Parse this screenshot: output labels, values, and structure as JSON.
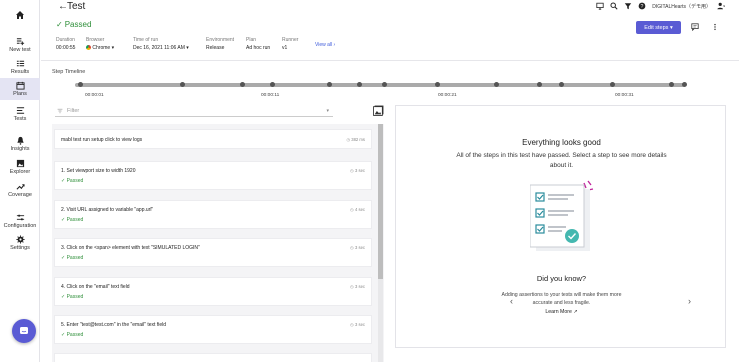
{
  "sidebar": {
    "home": "home",
    "items": [
      {
        "label": "New test",
        "icon": "new-test-icon"
      },
      {
        "label": "Results",
        "icon": "results-icon"
      },
      {
        "label": "Plans",
        "icon": "calendar-icon"
      },
      {
        "label": "Tests",
        "icon": "tests-icon"
      },
      {
        "label": "Insights",
        "icon": "bell-icon"
      },
      {
        "label": "Explorer",
        "icon": "image-icon"
      },
      {
        "label": "Coverage",
        "icon": "trend-icon"
      },
      {
        "label": "Configuration",
        "icon": "sliders-icon"
      },
      {
        "label": "Settings",
        "icon": "gear-icon"
      }
    ]
  },
  "header": {
    "title": "Test",
    "org": "DIGITALHearts（デモ用）",
    "status": "Passed"
  },
  "meta": {
    "duration_label": "Duration",
    "duration": "00:00:55",
    "browser_label": "Browser",
    "browser": "Chrome",
    "time_label": "Time of run",
    "time": "Dec 16, 2021 11:06 AM",
    "env_label": "Environment",
    "env": "Release",
    "plan_label": "Plan",
    "plan": "Ad hoc run",
    "runner_label": "Runner",
    "runner": "v1",
    "view_all": "View all ›"
  },
  "toolbar": {
    "edit_steps": "Edit steps ▾"
  },
  "timeline": {
    "label": "Step Timeline",
    "ticks": [
      "00:00:01",
      "00:00:11",
      "00:00:21",
      "00:00:31"
    ]
  },
  "filter": {
    "placeholder": "Filter"
  },
  "steps": [
    {
      "title": "mabl test run setup click to view logs",
      "status": "",
      "duration": "382 ms"
    },
    {
      "title": "1. Set viewport size to width 1920",
      "status": "Passed",
      "duration": "3 sec"
    },
    {
      "title": "2. Visit URL assigned to variable \"app.url\"",
      "status": "Passed",
      "duration": "4 sec"
    },
    {
      "title": "3. Click on the <span> element with text \"SIMULATED LOGIN\"",
      "status": "Passed",
      "duration": "3 sec"
    },
    {
      "title": "4. Click on the \"email\" text field",
      "status": "Passed",
      "duration": "3 sec"
    },
    {
      "title": "5. Enter \"test@test.com\" in the \"email\" text field",
      "status": "Passed",
      "duration": "3 sec"
    }
  ],
  "panel": {
    "heading": "Everything looks good",
    "subtext": "All of the steps in this test have passed. Select a step to see more details about it.",
    "did_you_know": "Did you know?",
    "tip": "Adding assertions to your tests will make them more accurate and less fragile.",
    "learn_more": "Learn More"
  },
  "colors": {
    "accent": "#5a5bd4",
    "success": "#2f8f3a",
    "link": "#3d5adb"
  }
}
